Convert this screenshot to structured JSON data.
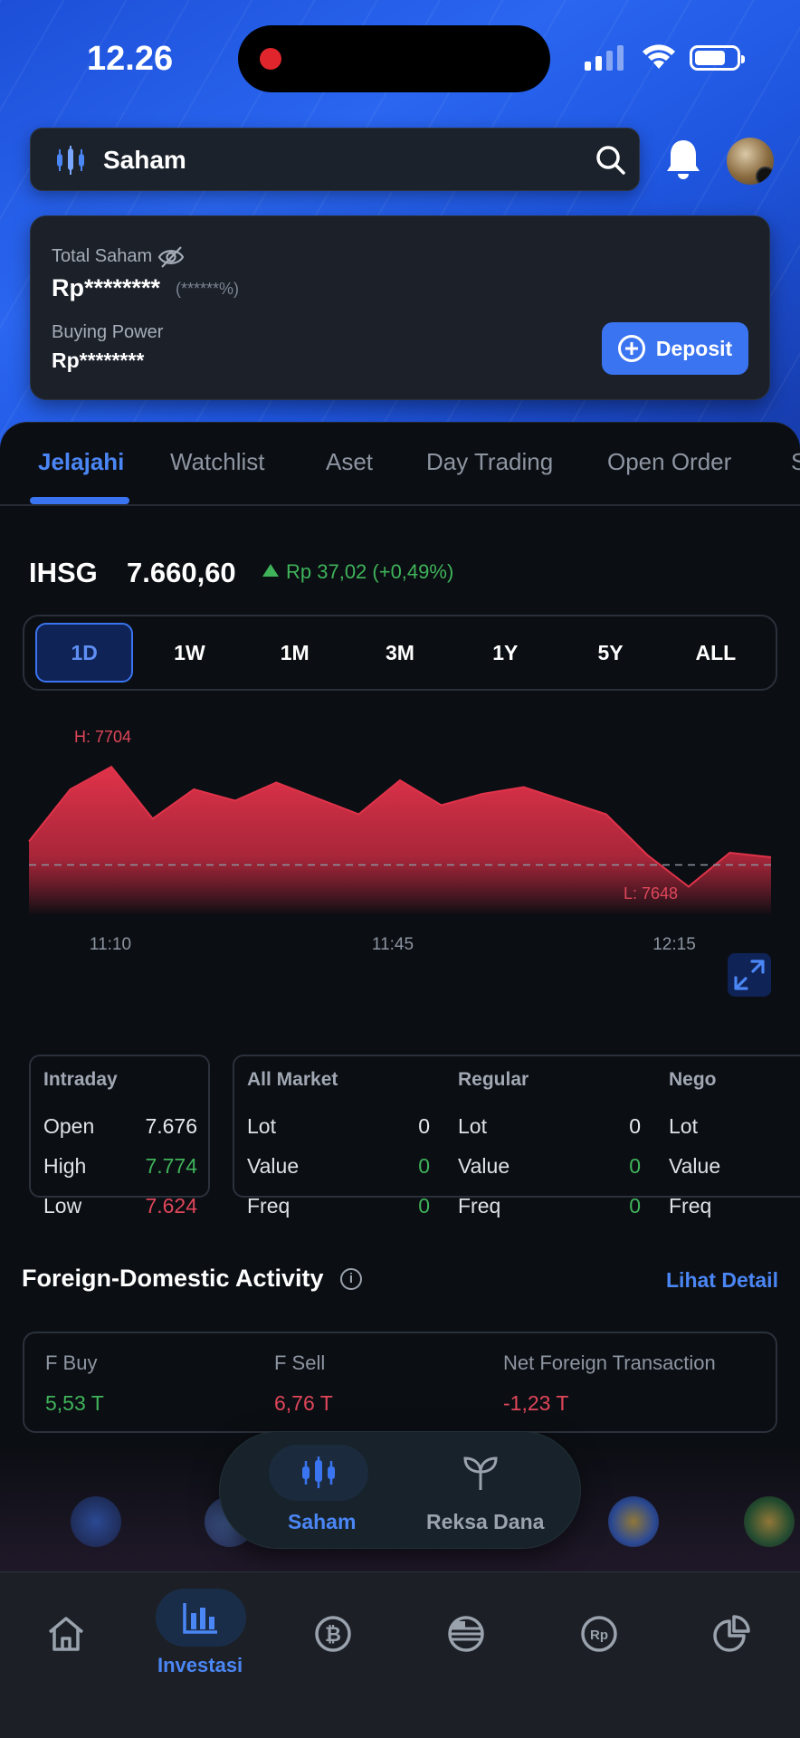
{
  "status_bar": {
    "time": "12.26"
  },
  "search": {
    "label": "Saham"
  },
  "portfolio": {
    "total_label": "Total Saham",
    "total_value": "Rp********",
    "total_pct": "(******%)",
    "buying_power_label": "Buying Power",
    "buying_power_value": "Rp********",
    "deposit_label": "Deposit"
  },
  "tabs": [
    {
      "label": "Jelajahi",
      "active": true
    },
    {
      "label": "Watchlist"
    },
    {
      "label": "Aset"
    },
    {
      "label": "Day Trading"
    },
    {
      "label": "Open Order"
    },
    {
      "label": "S"
    }
  ],
  "index": {
    "name": "IHSG",
    "value": "7.660,60",
    "change": "Rp 37,02 (+0,49%)"
  },
  "periods": [
    "1D",
    "1W",
    "1M",
    "3M",
    "1Y",
    "5Y",
    "ALL"
  ],
  "active_period": "1D",
  "chart_data": {
    "type": "area",
    "x": [
      "11:00",
      "11:05",
      "11:10",
      "11:15",
      "11:20",
      "11:25",
      "11:30",
      "11:35",
      "11:40",
      "11:45",
      "11:50",
      "11:55",
      "12:00",
      "12:05",
      "12:10",
      "12:15",
      "12:20",
      "12:25",
      "12:28"
    ],
    "values": [
      7671,
      7694,
      7704,
      7681,
      7694,
      7689,
      7697,
      7690,
      7683,
      7698,
      7687,
      7692,
      7695,
      7689,
      7683,
      7665,
      7651,
      7666,
      7664
    ],
    "baseline": 7660.6,
    "high_label": "H: 7704",
    "low_label": "L: 7648",
    "x_ticks": [
      "11:10",
      "11:45",
      "12:15"
    ],
    "color": "#e0334a"
  },
  "intraday": {
    "title": "Intraday",
    "rows": [
      {
        "label": "Open",
        "value": "7.676",
        "color": "#e6e9ee"
      },
      {
        "label": "High",
        "value": "7.774",
        "color": "#3fb35a"
      },
      {
        "label": "Low",
        "value": "7.624",
        "color": "#e0465a"
      }
    ]
  },
  "markets": [
    {
      "title": "All Market",
      "rows": [
        {
          "label": "Lot",
          "value": "0"
        },
        {
          "label": "Value",
          "value": "0"
        },
        {
          "label": "Freq",
          "value": "0"
        }
      ]
    },
    {
      "title": "Regular",
      "rows": [
        {
          "label": "Lot",
          "value": "0"
        },
        {
          "label": "Value",
          "value": "0"
        },
        {
          "label": "Freq",
          "value": "0"
        }
      ]
    },
    {
      "title": "Nego",
      "rows": [
        {
          "label": "Lot"
        },
        {
          "label": "Value"
        },
        {
          "label": "Freq"
        }
      ]
    }
  ],
  "foreign": {
    "title": "Foreign-Domestic Activity",
    "detail_link": "Lihat Detail",
    "items": [
      {
        "label": "F Buy",
        "value": "5,53 T",
        "color": "#3fb35a"
      },
      {
        "label": "F Sell",
        "value": "6,76 T",
        "color": "#e0465a"
      },
      {
        "label": "Net Foreign Transaction",
        "value": "-1,23 T",
        "color": "#e0465a"
      }
    ]
  },
  "switcher": {
    "items": [
      {
        "label": "Saham",
        "active": true
      },
      {
        "label": "Reksa Dana"
      }
    ]
  },
  "bottom_nav": {
    "items": [
      {
        "icon": "home-icon"
      },
      {
        "icon": "investment-chart-icon",
        "label": "Investasi",
        "active": true
      },
      {
        "icon": "crypto-bitcoin-icon"
      },
      {
        "icon": "us-flag-globe-icon"
      },
      {
        "icon": "rupiah-icon"
      },
      {
        "icon": "pie-chart-icon"
      }
    ]
  }
}
